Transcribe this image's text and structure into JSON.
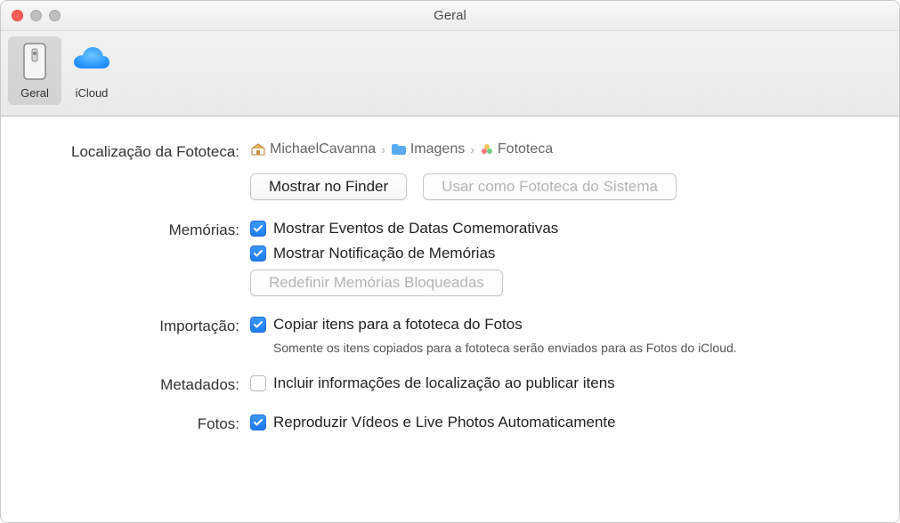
{
  "window": {
    "title": "Geral"
  },
  "toolbar": {
    "items": [
      {
        "label": "Geral",
        "selected": true
      },
      {
        "label": "iCloud",
        "selected": false
      }
    ]
  },
  "library_location": {
    "label": "Localização da Fototeca:",
    "breadcrumb": [
      {
        "name": "MichaelCavanna",
        "icon": "home"
      },
      {
        "name": "Imagens",
        "icon": "folder"
      },
      {
        "name": "Fototeca",
        "icon": "photos"
      }
    ],
    "show_in_finder_label": "Mostrar no Finder",
    "use_as_system_label": "Usar como Fototeca do Sistema"
  },
  "memories": {
    "label": "Memórias:",
    "show_holidays_label": "Mostrar Eventos de Datas Comemorativas",
    "show_notification_label": "Mostrar Notificação de Memórias",
    "reset_blocked_label": "Redefinir Memórias Bloqueadas"
  },
  "import": {
    "label": "Importação:",
    "copy_items_label": "Copiar itens para a fototeca do Fotos",
    "copy_items_subtext": "Somente os itens copiados para a fototeca serão enviados para as Fotos do iCloud."
  },
  "metadata": {
    "label": "Metadados:",
    "include_location_label": "Incluir informações de localização ao publicar itens"
  },
  "photos": {
    "label": "Fotos:",
    "autoplay_label": "Reproduzir Vídeos e Live Photos Automaticamente"
  }
}
